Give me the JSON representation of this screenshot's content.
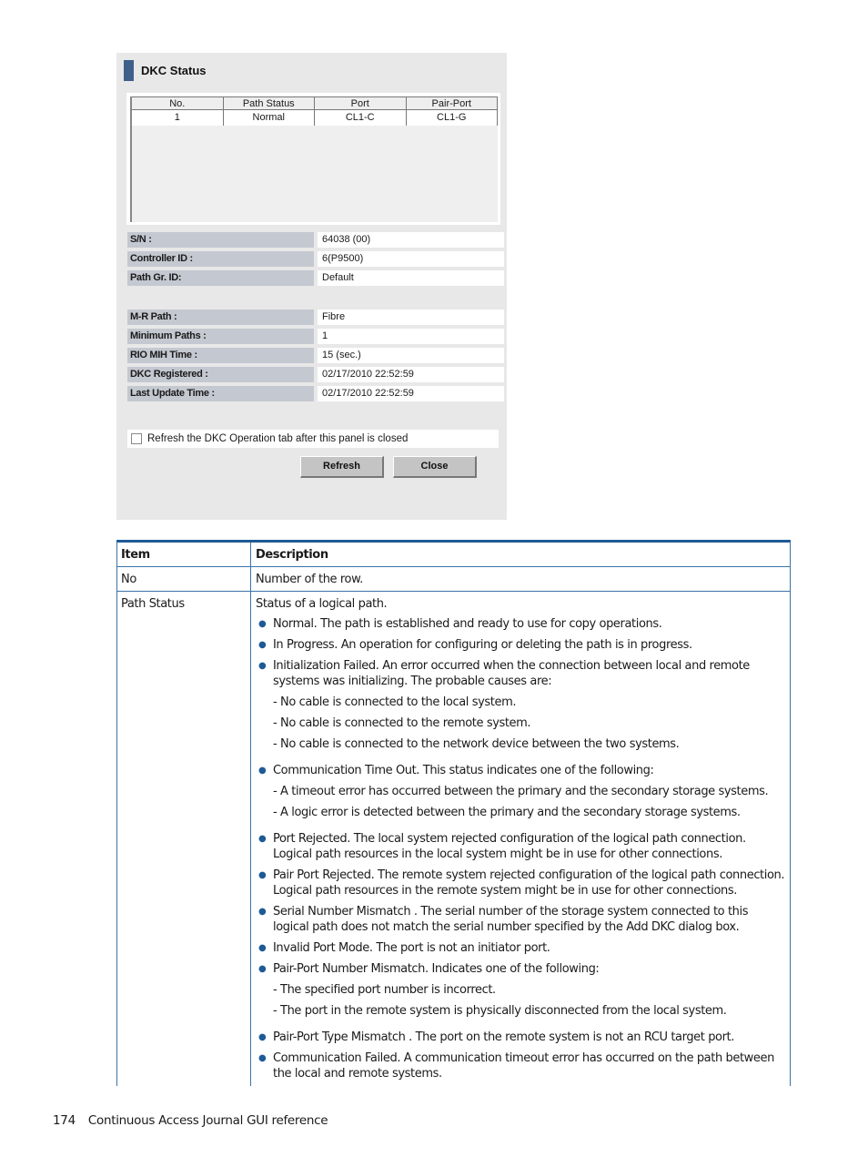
{
  "panel": {
    "title": "DKC Status",
    "grid": {
      "columns": [
        "No.",
        "Path Status",
        "Port",
        "Pair-Port"
      ],
      "rows": [
        [
          "1",
          "Normal",
          "CL1-C",
          "CL1-G"
        ]
      ]
    },
    "properties": [
      {
        "label": "S/N :",
        "value": "64038 (00)"
      },
      {
        "label": "Controller ID :",
        "value": "6(P9500)"
      },
      {
        "label": "Path Gr. ID:",
        "value": "Default"
      },
      {
        "label": "M-R Path :",
        "value": "Fibre"
      },
      {
        "label": "Minimum Paths :",
        "value": "1"
      },
      {
        "label": "RIO MIH Time :",
        "value": "15 (sec.)"
      },
      {
        "label": "DKC Registered :",
        "value": "02/17/2010 22:52:59"
      },
      {
        "label": "Last Update Time :",
        "value": "02/17/2010 22:52:59"
      }
    ],
    "checkbox_label": "Refresh the DKC Operation tab after this panel is closed",
    "checkbox_checked": false,
    "refresh_label": "Refresh",
    "close_label": "Close"
  },
  "table": {
    "headers": {
      "item": "Item",
      "description": "Description"
    },
    "rows": [
      {
        "item": "No",
        "intro": "Number of the row."
      },
      {
        "item": "Path Status",
        "intro": "Status of a logical path.",
        "bullets": [
          {
            "text": "Normal. The path is established and ready to use for copy operations."
          },
          {
            "text": "In Progress. An operation for configuring or deleting the path is in progress."
          },
          {
            "text": "Initialization Failed. An error occurred when the connection between local and remote systems was initializing. The probable causes are:",
            "subs": [
              "- No cable is connected to the local system.",
              "- No cable is connected to the remote system.",
              "- No cable is connected to the network device between the two systems."
            ]
          },
          {
            "text": "Communication Time Out. This status indicates one of the following:",
            "subs": [
              "- A timeout error has occurred between the primary and the secondary storage systems.",
              "- A logic error is detected between the primary and the secondary storage systems."
            ]
          },
          {
            "text": "Port Rejected. The local system rejected configuration of the logical path connection. Logical path resources in the local system might be in use for other connections."
          },
          {
            "text": "Pair Port Rejected. The remote system rejected configuration of the logical path connection. Logical path resources in the remote system might be in use for other connections."
          },
          {
            "text": "Serial Number Mismatch . The serial number of the storage system connected to this logical path does not match the serial number specified by the Add DKC dialog box."
          },
          {
            "text": "Invalid Port Mode. The port is not an initiator port."
          },
          {
            "text": "Pair-Port Number Mismatch. Indicates one of the following:",
            "subs": [
              "- The specified port number is incorrect.",
              "- The port in the remote system is physically disconnected from the local system."
            ]
          },
          {
            "text": "Pair-Port Type Mismatch . The port on the remote system is not an RCU target port."
          },
          {
            "text": "Communication Failed. A communication timeout error has occurred on the path between the local and remote systems."
          }
        ]
      }
    ]
  },
  "footer": {
    "page_number": "174",
    "section_title": "Continuous Access Journal GUI reference"
  }
}
